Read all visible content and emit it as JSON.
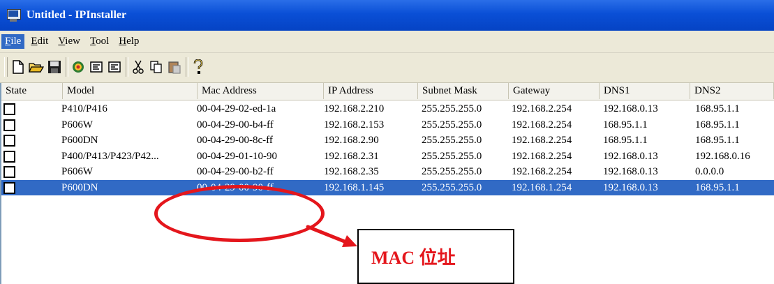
{
  "window": {
    "title": "Untitled - IPInstaller"
  },
  "menubar": {
    "items": [
      {
        "label": "File",
        "underline": "F",
        "rest": "ile",
        "active": true
      },
      {
        "label": "Edit",
        "underline": "E",
        "rest": "dit"
      },
      {
        "label": "View",
        "underline": "V",
        "rest": "iew"
      },
      {
        "label": "Tool",
        "underline": "T",
        "rest": "ool"
      },
      {
        "label": "Help",
        "underline": "H",
        "rest": "elp"
      }
    ]
  },
  "toolbar": {
    "buttons": [
      "new-icon",
      "open-folder-icon",
      "save-icon",
      "search-device-icon",
      "config-icon",
      "config2-icon",
      "cut-icon",
      "copy-icon",
      "paste-icon",
      "help-icon"
    ]
  },
  "table": {
    "columns": [
      "State",
      "Model",
      "Mac Address",
      "IP Address",
      "Subnet Mask",
      "Gateway",
      "DNS1",
      "DNS2"
    ],
    "rows": [
      [
        "",
        "P410/P416",
        "00-04-29-02-ed-1a",
        "192.168.2.210",
        "255.255.255.0",
        "192.168.2.254",
        "192.168.0.13",
        "168.95.1.1"
      ],
      [
        "",
        "P606W",
        "00-04-29-00-b4-ff",
        "192.168.2.153",
        "255.255.255.0",
        "192.168.2.254",
        "168.95.1.1",
        "168.95.1.1"
      ],
      [
        "",
        "P600DN",
        "00-04-29-00-8c-ff",
        "192.168.2.90",
        "255.255.255.0",
        "192.168.2.254",
        "168.95.1.1",
        "168.95.1.1"
      ],
      [
        "",
        "P400/P413/P423/P42...",
        "00-04-29-01-10-90",
        "192.168.2.31",
        "255.255.255.0",
        "192.168.2.254",
        "192.168.0.13",
        "192.168.0.16"
      ],
      [
        "",
        "P606W",
        "00-04-29-00-b2-ff",
        "192.168.2.35",
        "255.255.255.0",
        "192.168.2.254",
        "192.168.0.13",
        "0.0.0.0"
      ],
      [
        "",
        "P600DN",
        "00-04-29-00-90-ff",
        "192.168.1.145",
        "255.255.255.0",
        "192.168.1.254",
        "192.168.0.13",
        "168.95.1.1"
      ]
    ],
    "selected_row": 5
  },
  "annotation": {
    "label": "MAC 位址",
    "color": "#e4161c"
  }
}
